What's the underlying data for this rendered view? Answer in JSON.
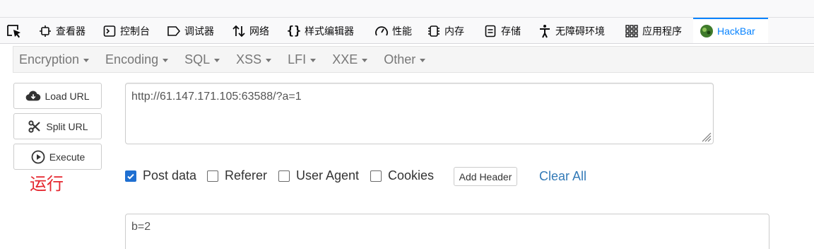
{
  "devtools": {
    "tabs": [
      {
        "label": "查看器",
        "icon": "inspector-icon"
      },
      {
        "label": "控制台",
        "icon": "console-icon"
      },
      {
        "label": "调试器",
        "icon": "debugger-icon"
      },
      {
        "label": "网络",
        "icon": "network-icon"
      },
      {
        "label": "样式编辑器",
        "icon": "style-editor-icon"
      },
      {
        "label": "性能",
        "icon": "performance-icon"
      },
      {
        "label": "内存",
        "icon": "memory-icon"
      },
      {
        "label": "存储",
        "icon": "storage-icon"
      },
      {
        "label": "无障碍环境",
        "icon": "accessibility-icon"
      },
      {
        "label": "应用程序",
        "icon": "application-icon"
      },
      {
        "label": "HackBar",
        "icon": "hackbar-icon"
      }
    ],
    "active_tab": "HackBar",
    "accent_color": "#0a84ff"
  },
  "menu": [
    {
      "label": "Encryption"
    },
    {
      "label": "Encoding"
    },
    {
      "label": "SQL"
    },
    {
      "label": "XSS"
    },
    {
      "label": "LFI"
    },
    {
      "label": "XXE"
    },
    {
      "label": "Other"
    }
  ],
  "actions": {
    "load_url": "Load URL",
    "split_url": "Split URL",
    "execute": "Execute"
  },
  "annotation_text": "运行",
  "annotation_color": "#e5262e",
  "url_value": "http://61.147.171.105:63588/?a=1",
  "options": {
    "post_data": {
      "label": "Post data",
      "checked": true
    },
    "referer": {
      "label": "Referer",
      "checked": false
    },
    "user_agent": {
      "label": "User Agent",
      "checked": false
    },
    "cookies": {
      "label": "Cookies",
      "checked": false
    },
    "add_header": "Add Header",
    "clear_all": "Clear All"
  },
  "post_body": "b=2"
}
